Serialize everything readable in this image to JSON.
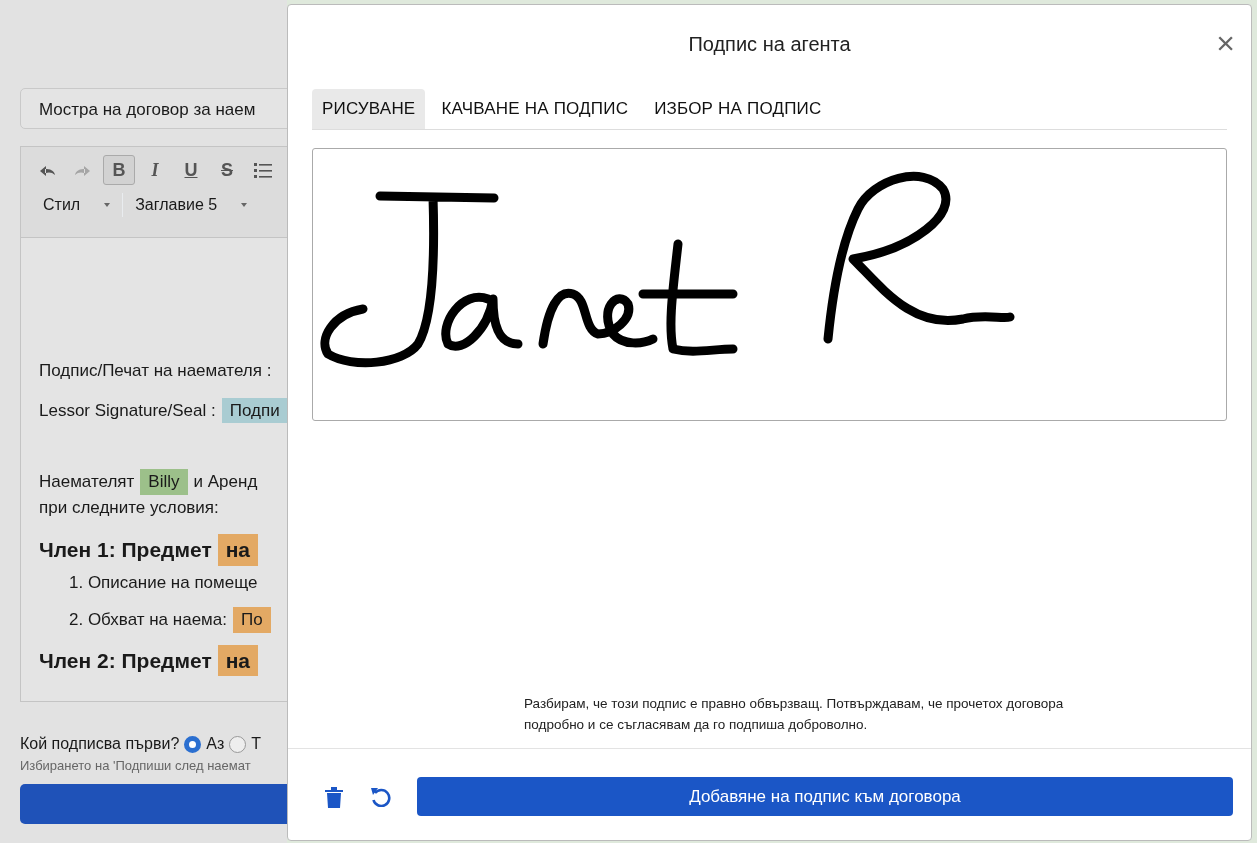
{
  "page": {
    "document_title": "Мостра на договор за наем",
    "toolbar": [
      {
        "kind": "undo",
        "disabled": false,
        "selected": false
      },
      {
        "kind": "redo",
        "disabled": true,
        "selected": false
      },
      {
        "kind": "bold",
        "label": "B",
        "disabled": false,
        "selected": true
      },
      {
        "kind": "italic",
        "label": "I",
        "disabled": false,
        "selected": false
      },
      {
        "kind": "underline",
        "label": "U",
        "disabled": false,
        "selected": false
      },
      {
        "kind": "strike",
        "label": "S",
        "disabled": false,
        "selected": false
      },
      {
        "kind": "list",
        "disabled": false,
        "selected": false
      }
    ],
    "dropdowns": [
      "Стил",
      "Заглавие 5"
    ],
    "blocks": [
      {
        "kind": "paragraph",
        "lines": [
          [
            {
              "text": "Подпис/Печат на наемателя :"
            }
          ]
        ]
      },
      {
        "kind": "paragraph",
        "lines": [
          [
            {
              "text": "Lessor  Signature/Seal :"
            },
            {
              "text": "Подпи",
              "color": "#a9ccd2"
            }
          ]
        ]
      },
      {
        "kind": "paragraph",
        "lines": [
          [
            {
              "text": "Наемателят"
            },
            {
              "text": "Billy",
              "color": "#9cc08a"
            },
            {
              "text": "и Аренд"
            }
          ],
          [
            {
              "text": "при следните условия:"
            }
          ]
        ]
      },
      {
        "kind": "heading",
        "lines": [
          [
            {
              "text": "Член 1: Предмет"
            },
            {
              "text": "на",
              "color": "#e3a964"
            }
          ]
        ]
      },
      {
        "kind": "list_item",
        "lines": [
          [
            {
              "text": "1. Описание на помеще"
            }
          ]
        ]
      },
      {
        "kind": "list_item",
        "lines": [
          [
            {
              "text": "2. Обхват на наема:"
            },
            {
              "text": "По",
              "color": "#e3a964"
            }
          ]
        ]
      },
      {
        "kind": "heading",
        "lines": [
          [
            {
              "text": "Член 2: Предмет"
            },
            {
              "text": "на",
              "color": "#e3a964"
            }
          ]
        ]
      }
    ],
    "signing_order": {
      "question": "Кой подписва първи?",
      "options": [
        {
          "label": "Аз",
          "selected": true
        },
        {
          "label": "Т",
          "selected": false
        }
      ]
    },
    "hint": "Избирането на 'Подпиши след наемат"
  },
  "dialog": {
    "title": "Подпис на агента",
    "close": "×",
    "tabs": [
      {
        "label": "РИСУВАНЕ",
        "selected": true
      },
      {
        "label": "КАЧВАНЕ НА ПОДПИС",
        "selected": false
      },
      {
        "label": "ИЗБОР НА ПОДПИС",
        "selected": false
      }
    ],
    "disclaimer": "Разбирам, че този подпис е правно обвързващ. Потвърждавам, че прочетох договора подробно и се съгласявам да го подпиша доброволно.",
    "submit": "Добавяне на подпис към договора"
  }
}
